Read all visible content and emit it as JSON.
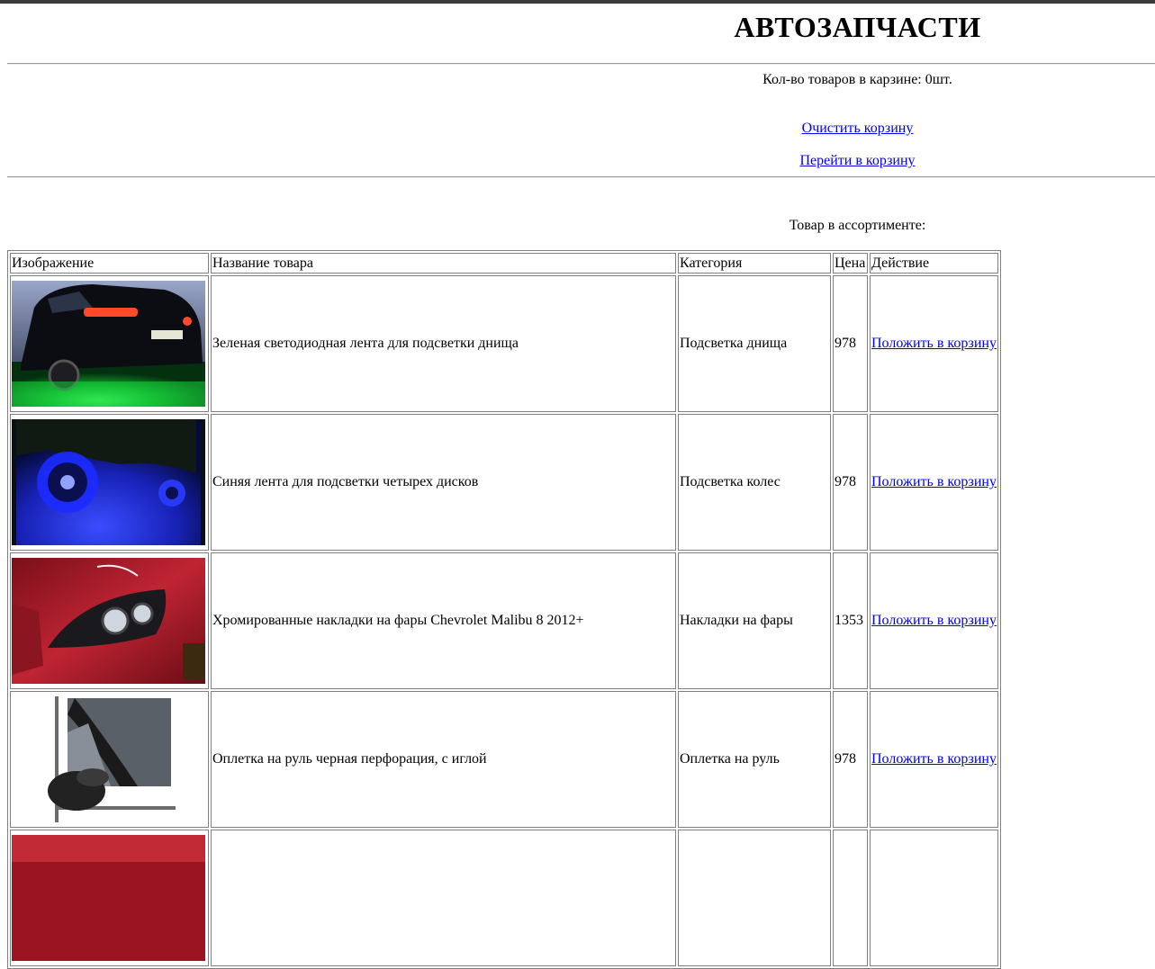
{
  "header": {
    "title": "АВТОЗАПЧАСТИ"
  },
  "cart": {
    "count_text": "Кол-во товаров в карзине: 0шт.",
    "clear_link": "Очистить корзину",
    "goto_link": "Перейти в корзину"
  },
  "catalog": {
    "heading": "Товар в ассортименте:",
    "columns": [
      "Изображение",
      "Название товара",
      "Категория",
      "Цена",
      "Действие"
    ],
    "rows": [
      {
        "name": "Зеленая светодиодная лента для подсветки днища",
        "category": "Подсветка днища",
        "price": "978",
        "action": "Положить в корзину",
        "image_icon": "car-underglow-green-photo"
      },
      {
        "name": "Синяя лента для подсветки четырех дисков",
        "category": "Подсветка колес",
        "price": "978",
        "action": "Положить в корзину",
        "image_icon": "car-wheel-blue-light-photo"
      },
      {
        "name": "Хромированные накладки на фары Chevrolet Malibu 8 2012+",
        "category": "Накладки на фары",
        "price": "1353",
        "action": "Положить в корзину",
        "image_icon": "red-car-headlight-photo"
      },
      {
        "name": "Оплетка на руль черная перфорация, с иглой",
        "category": "Оплетка на руль",
        "price": "978",
        "action": "Положить в корзину",
        "image_icon": "steering-wheel-cover-photo"
      },
      {
        "name": "",
        "category": "",
        "price": "",
        "action": "",
        "image_icon": "red-car-photo"
      }
    ]
  }
}
